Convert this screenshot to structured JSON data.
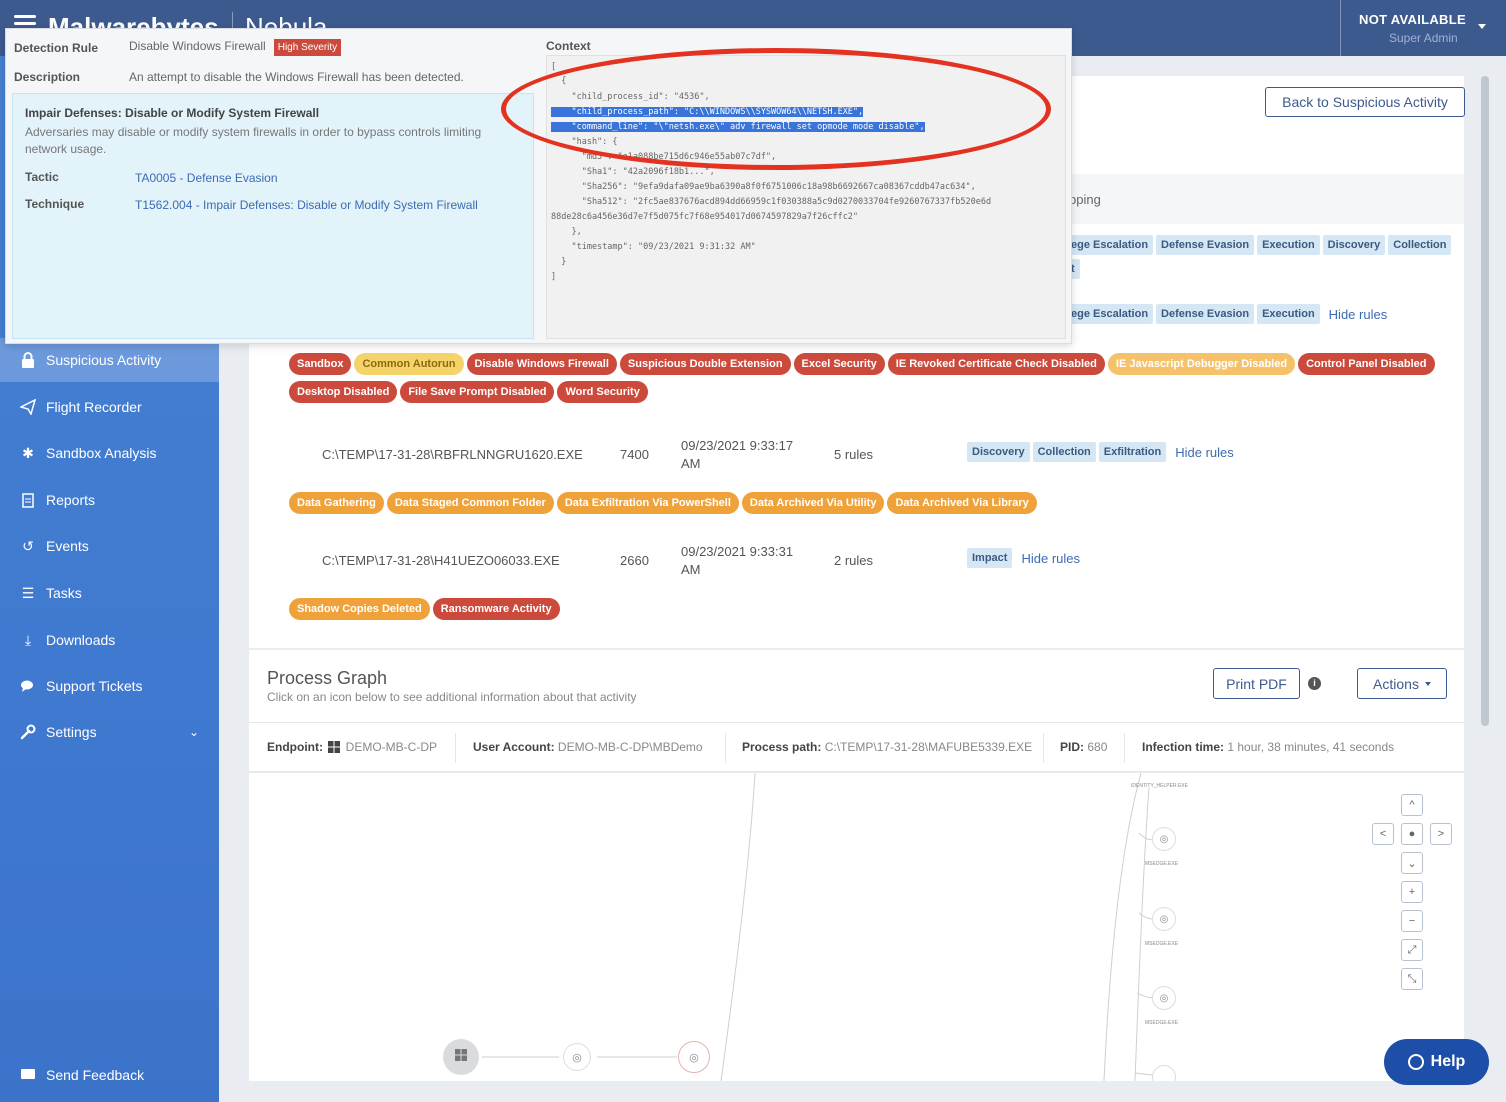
{
  "topbar": {
    "brand": "Malwarebytes",
    "product": "Nebula",
    "user_name": "NOT AVAILABLE",
    "user_role": "Super Admin"
  },
  "sidebar": {
    "items": [
      {
        "label": "Suspicious Activity",
        "icon": "lock-icon",
        "active": true
      },
      {
        "label": "Flight Recorder",
        "icon": "paper-plane-icon"
      },
      {
        "label": "Sandbox Analysis",
        "icon": "bug-icon"
      },
      {
        "label": "Reports",
        "icon": "document-icon"
      },
      {
        "label": "Events",
        "icon": "history-icon"
      },
      {
        "label": "Tasks",
        "icon": "list-icon"
      },
      {
        "label": "Downloads",
        "icon": "download-icon"
      },
      {
        "label": "Support Tickets",
        "icon": "chat-icon"
      },
      {
        "label": "Settings",
        "icon": "wrench-icon"
      }
    ],
    "feedback": "Send Feedback"
  },
  "header": {
    "back_button": "Back to Suspicious Activity",
    "mapping_fragment": "pping"
  },
  "tactics_top": {
    "row1": [
      "ege Escalation",
      "Defense Evasion",
      "Execution",
      "Discovery",
      "Collection"
    ],
    "row1b": "t",
    "row2": [
      "ege Escalation",
      "Defense Evasion",
      "Execution"
    ],
    "hide_rules": "Hide rules"
  },
  "rule_tags_1": [
    {
      "label": "Sandbox",
      "color": "red"
    },
    {
      "label": "Common Autorun",
      "color": "yellow"
    },
    {
      "label": "Disable Windows Firewall",
      "color": "red"
    },
    {
      "label": "Suspicious Double Extension",
      "color": "red"
    },
    {
      "label": "Excel Security",
      "color": "red"
    },
    {
      "label": "IE Revoked Certificate Check Disabled",
      "color": "red"
    },
    {
      "label": "IE Javascript Debugger Disabled",
      "color": "lorange"
    },
    {
      "label": "Control Panel Disabled",
      "color": "red"
    },
    {
      "label": "Desktop Disabled",
      "color": "red"
    },
    {
      "label": "File Save Prompt Disabled",
      "color": "red"
    },
    {
      "label": "Word Security",
      "color": "red"
    }
  ],
  "processes": [
    {
      "path": "C:\\TEMP\\17-31-28\\RBFRLNNGRU1620.EXE",
      "pid": "7400",
      "time": "09/23/2021 9:33:17 AM",
      "rules": "5 rules",
      "tactics": [
        "Discovery",
        "Collection",
        "Exfiltration"
      ],
      "hide": "Hide rules",
      "tags": [
        {
          "label": "Data Gathering",
          "color": "orange"
        },
        {
          "label": "Data Staged Common Folder",
          "color": "orange"
        },
        {
          "label": "Data Exfiltration Via PowerShell",
          "color": "orange"
        },
        {
          "label": "Data Archived Via Utility",
          "color": "orange"
        },
        {
          "label": "Data Archived Via Library",
          "color": "orange"
        }
      ]
    },
    {
      "path": "C:\\TEMP\\17-31-28\\H41UEZO06033.EXE",
      "pid": "2660",
      "time": "09/23/2021 9:33:31 AM",
      "rules": "2 rules",
      "tactics": [
        "Impact"
      ],
      "hide": "Hide rules",
      "tags": [
        {
          "label": "Shadow Copies Deleted",
          "color": "orange"
        },
        {
          "label": "Ransomware Activity",
          "color": "red"
        }
      ]
    }
  ],
  "process_graph": {
    "title": "Process Graph",
    "subtitle": "Click on an icon below to see additional information about that activity",
    "print_pdf": "Print PDF",
    "actions": "Actions",
    "info": {
      "endpoint_label": "Endpoint:",
      "endpoint_value": "DEMO-MB-C-DP",
      "account_label": "User Account:",
      "account_value": "DEMO-MB-C-DP\\MBDemo",
      "path_label": "Process path:",
      "path_value": "C:\\TEMP\\17-31-28\\MAFUBE5339.EXE",
      "pid_label": "PID:",
      "pid_value": "680",
      "infection_label": "Infection time:",
      "infection_value": "1 hour, 38 minutes, 41 seconds"
    },
    "node_labels": [
      "IDENTITY_HELPER.EXE",
      "MSEDGE.EXE",
      "MSEDGE.EXE",
      "MSEDGE.EXE"
    ]
  },
  "help": "Help",
  "popover": {
    "rule_label": "Detection Rule",
    "rule_value": "Disable Windows Firewall",
    "severity": "High Severity",
    "desc_label": "Description",
    "desc_value": "An attempt to disable the Windows Firewall has been detected.",
    "mitre_title": "Impair Defenses: Disable or Modify System Firewall",
    "mitre_desc": "Adversaries may disable or modify system firewalls in order to bypass controls limiting network usage.",
    "tactic_label": "Tactic",
    "tactic_value": "TA0005 - Defense Evasion",
    "technique_label": "Technique",
    "technique_value": "T1562.004 - Impair Defenses: Disable or Modify System Firewall",
    "context_label": "Context",
    "code_lines": [
      "[",
      "  {",
      "    \"child_process_id\": \"4536\",",
      "    \"child_process_path\": \"C:\\\\WINDOWS\\\\SYSWOW64\\\\NETSH.EXE\",",
      "    \"command_line\": \"\\\"netsh.exe\\\" adv firewall set opmode mode disable\",",
      "    \"hash\": {",
      "      \"md5\": \"a1a088be715d6c946e55ab07c7df\",",
      "      \"Sha1\": \"42a2096f18b1...\",",
      "      \"Sha256\": \"9efa9dafa09ae9ba6390a8f0f6751006c18a98b6692667ca08367cddb47ac634\",",
      "      \"Sha512\": \"2fc5ae837676acd894dd66959c1f030388a5c9d0270033704fe9260767337fb520e6d",
      "88de28c6a456e36d7e7f5d075fc7f68e954017d0674597829a7f26cffc2\"",
      "    },",
      "    \"timestamp\": \"09/23/2021 9:31:32 AM\"",
      "  }",
      "]"
    ]
  },
  "colors": {
    "topbar": "#3d5a8f",
    "sidebar": "#4680d2",
    "red_tag": "#cc4a3b",
    "orange_tag": "#f0a23a",
    "annotation": "#e3321f",
    "highlight": "#3874d9"
  }
}
